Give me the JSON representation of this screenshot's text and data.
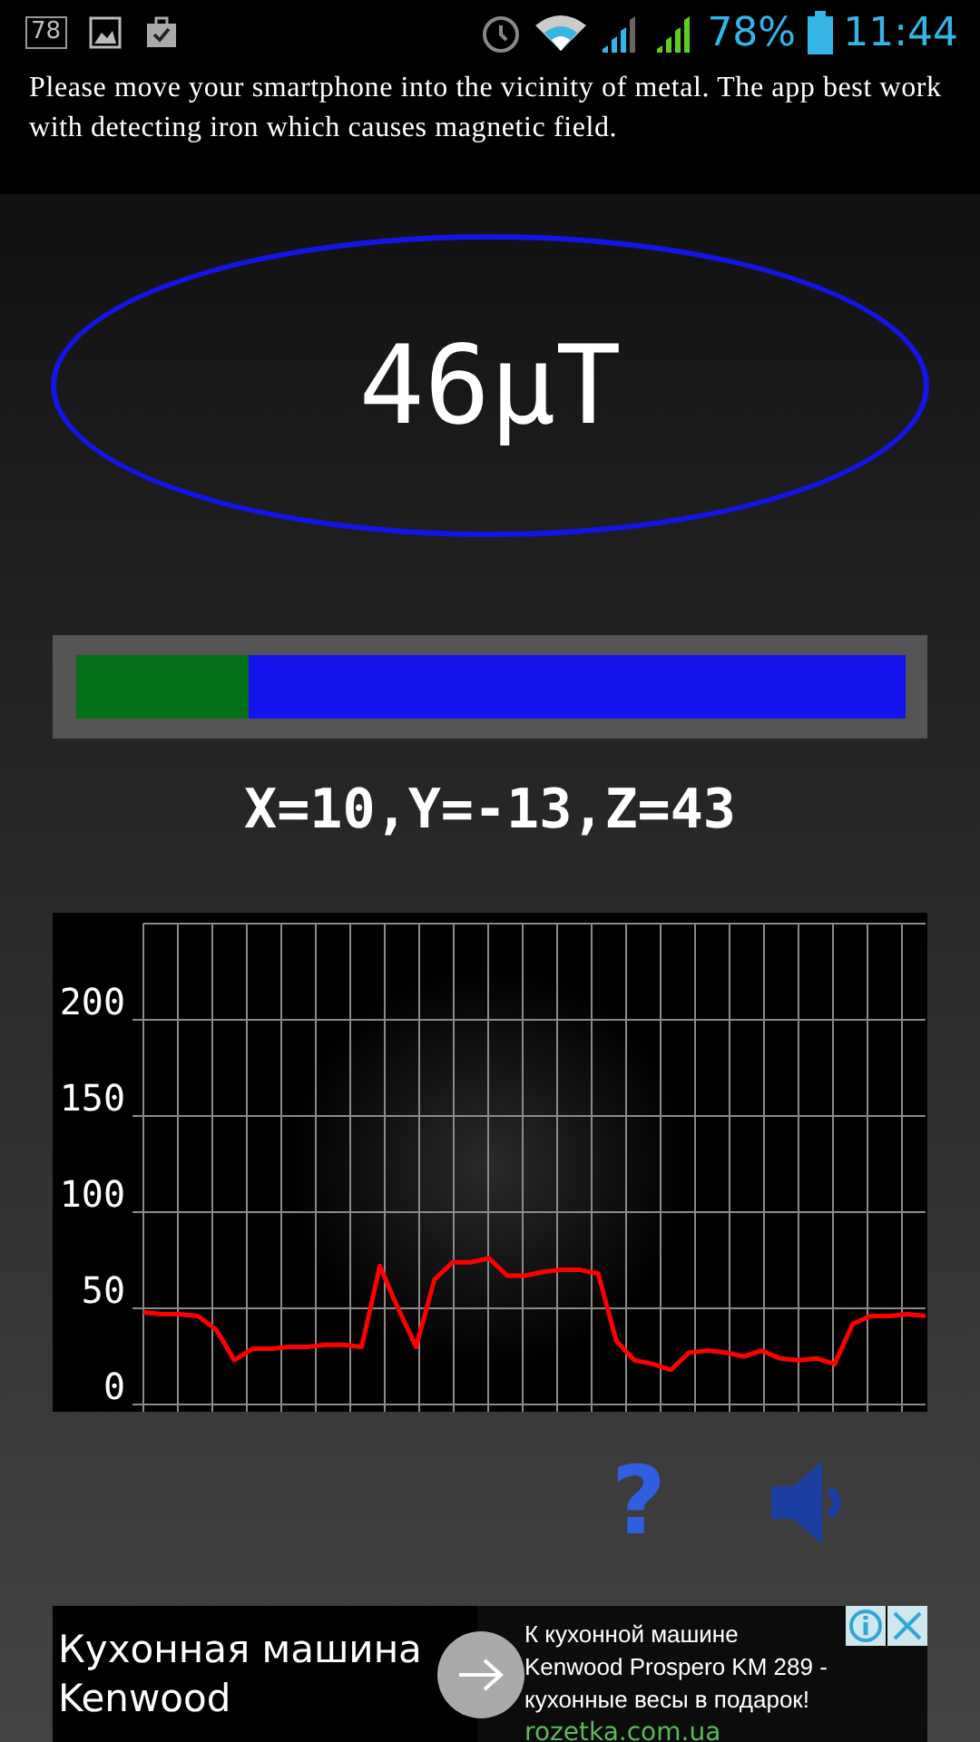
{
  "status_bar": {
    "notification_count": "78",
    "battery": "78%",
    "time": "11:44"
  },
  "instruction": "Please move your smartphone into the vicinity of metal. The app best work with detecting iron which causes magnetic field.",
  "reading": "46µT",
  "meter": {
    "level": 0.21
  },
  "axes": "X=10,Y=-13,Z=43",
  "chart_data": {
    "type": "line",
    "grid": true,
    "ylim": [
      0,
      250
    ],
    "yticks": [
      0,
      50,
      100,
      150,
      200
    ],
    "series": [
      {
        "color": "#ff0000",
        "values": [
          48,
          47,
          47,
          46,
          39,
          23,
          29,
          29,
          30,
          30,
          31,
          31,
          30,
          72,
          50,
          30,
          65,
          74,
          74,
          76,
          67,
          67,
          69,
          70,
          70,
          68,
          33,
          23,
          21,
          18,
          27,
          28,
          27,
          25,
          28,
          24,
          23,
          24,
          21,
          42,
          46,
          46,
          47,
          46
        ]
      }
    ]
  },
  "help": "?",
  "ad": {
    "headline": "Кухонная машина Kenwood",
    "body": "К кухонной машине Kenwood Prospero KM 289 - кухонные весы в подарок!",
    "url": "rozetka.com.ua"
  }
}
